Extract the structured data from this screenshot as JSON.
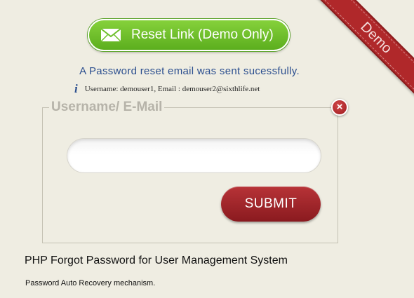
{
  "ribbon": {
    "label": "Demo"
  },
  "reset_link": {
    "label": "Reset Link (Demo Only)",
    "icon": "envelope-icon"
  },
  "status": {
    "message": "A Password reset email was sent sucessfully."
  },
  "info": {
    "icon": "info-icon",
    "icon_glyph": "i",
    "text": "Username: demouser1, Email : demouser2@sixthlife.net"
  },
  "form": {
    "legend": "Username/ E-Mail",
    "close_icon": "close-icon",
    "close_glyph": "×",
    "input_value": "",
    "submit_label": "SUBMIT"
  },
  "footer": {
    "title": "PHP Forgot Password for User Management System",
    "subtitle": "Password Auto Recovery mechanism."
  },
  "colors": {
    "background": "#efede2",
    "green_button": "#6dc02a",
    "red_accent": "#a8282b",
    "status_text": "#2c4f8f",
    "legend_text": "#b6b3a9"
  }
}
